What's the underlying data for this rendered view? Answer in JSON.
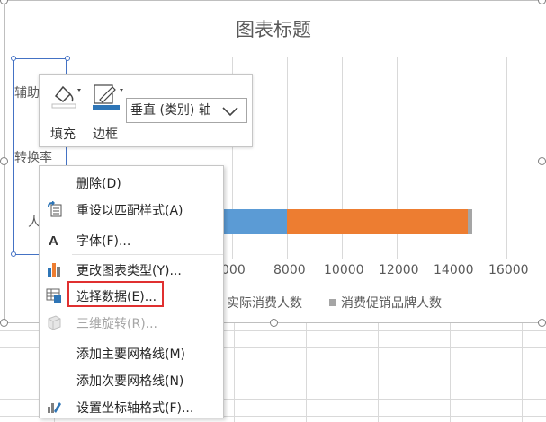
{
  "chart": {
    "title": "图表标题",
    "category_labels": [
      "辅助",
      "转换率",
      "人"
    ],
    "x_ticks": [
      "000",
      "8000",
      "10000",
      "12000",
      "14000",
      "16000"
    ],
    "legend": [
      "实际消费人数",
      "消费促销品牌人数"
    ]
  },
  "chart_data": {
    "type": "bar",
    "orientation": "horizontal",
    "title": "图表标题",
    "xlim": [
      0,
      16000
    ],
    "series": [
      {
        "name": "实际消费人数",
        "color": "#5b9bd5",
        "values": [
          8000
        ]
      },
      {
        "name": "消费促销品牌人数",
        "color": "#ed7d31",
        "values": [
          6600
        ]
      },
      {
        "name": "",
        "color": "#a5a5a5",
        "values": [
          150
        ]
      }
    ],
    "grid": true,
    "legend_position": "bottom"
  },
  "minibar": {
    "fill_label": "填充",
    "border_label": "边框",
    "element_select": "垂直 (类别) 轴"
  },
  "menu": {
    "items": [
      {
        "label": "删除(D)",
        "icon": "none"
      },
      {
        "label": "重设以匹配样式(A)",
        "icon": "reset-style-icon"
      },
      {
        "label": "字体(F)...",
        "icon": "font-icon"
      },
      {
        "label": "更改图表类型(Y)...",
        "icon": "chart-type-icon"
      },
      {
        "label": "选择数据(E)...",
        "icon": "select-data-icon"
      },
      {
        "label": "三维旋转(R)...",
        "icon": "3d-rotation-icon"
      },
      {
        "label": "添加主要网格线(M)",
        "icon": "none"
      },
      {
        "label": "添加次要网格线(N)",
        "icon": "none"
      },
      {
        "label": "设置坐标轴格式(F)...",
        "icon": "format-axis-icon"
      }
    ]
  },
  "colors": {
    "series_blue": "#5b9bd5",
    "series_orange": "#ed7d31",
    "series_gray": "#a5a5a5",
    "highlight_red": "#e03030"
  }
}
